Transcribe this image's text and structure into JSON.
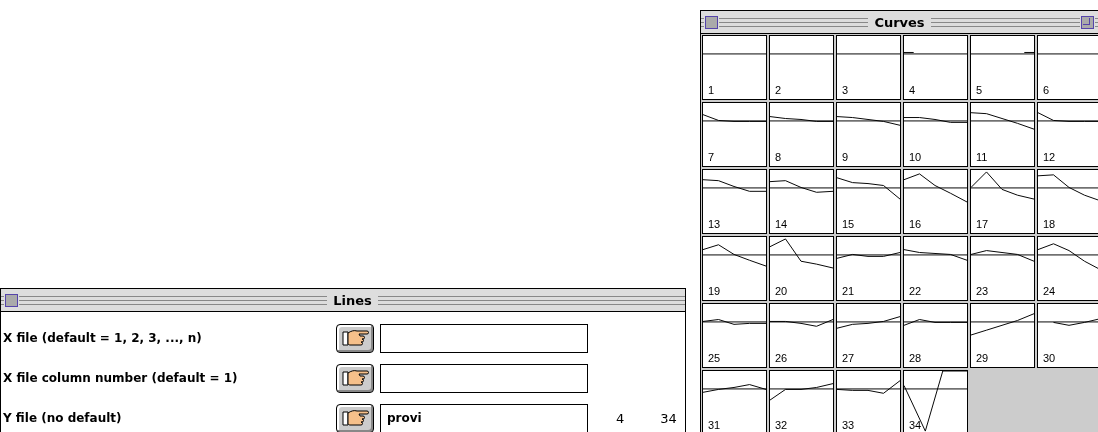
{
  "curves_window": {
    "title": "Curves",
    "has_zoom_box": true,
    "cells": [
      {
        "label": "1"
      },
      {
        "label": "2"
      },
      {
        "label": "3"
      },
      {
        "label": "4"
      },
      {
        "label": "5"
      },
      {
        "label": "6"
      },
      {
        "label": "7"
      },
      {
        "label": "8"
      },
      {
        "label": "9"
      },
      {
        "label": "10"
      },
      {
        "label": "11"
      },
      {
        "label": "12"
      },
      {
        "label": "13"
      },
      {
        "label": "14"
      },
      {
        "label": "15"
      },
      {
        "label": "16"
      },
      {
        "label": "17"
      },
      {
        "label": "18"
      },
      {
        "label": "19"
      },
      {
        "label": "20"
      },
      {
        "label": "21"
      },
      {
        "label": "22"
      },
      {
        "label": "23"
      },
      {
        "label": "24"
      },
      {
        "label": "25"
      },
      {
        "label": "26"
      },
      {
        "label": "27"
      },
      {
        "label": "28"
      },
      {
        "label": "29"
      },
      {
        "label": "30"
      },
      {
        "label": "31"
      },
      {
        "label": "32"
      },
      {
        "label": "33"
      },
      {
        "label": "34"
      }
    ]
  },
  "lines_window": {
    "title": "Lines",
    "rows": [
      {
        "label": "X file (default = 1, 2, 3, ..., n)"
      },
      {
        "label": "X file column number (default = 1)"
      },
      {
        "label": "Y file (no default)",
        "value": "provi",
        "readouts": [
          "4",
          "34"
        ]
      }
    ]
  }
}
